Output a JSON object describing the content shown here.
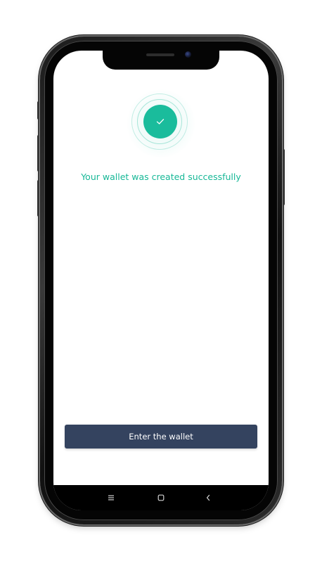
{
  "screen": {
    "success_message": "Your wallet was created successfully",
    "enter_button_label": "Enter the wallet"
  },
  "icons": {
    "success": "check-icon",
    "nav_menu": "menu-icon",
    "nav_home": "home-icon",
    "nav_back": "back-icon"
  },
  "colors": {
    "accent": "#1abc9c",
    "button": "#34435f",
    "button_text": "#ffffff",
    "navbar": "#000000"
  }
}
